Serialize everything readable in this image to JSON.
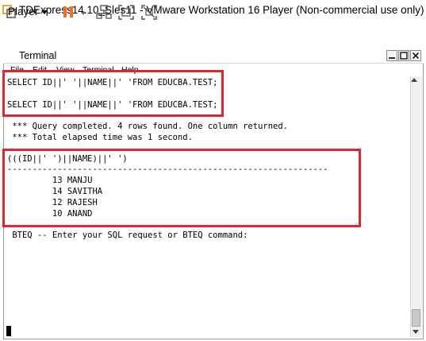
{
  "app": {
    "title": "TDExpress14.10_Sles11 - VMware Workstation 16 Player (Non-commercial use only)"
  },
  "toolbar": {
    "player_label": "Player",
    "icons": [
      "vmware-logo-icon",
      "pause-icon",
      "network-icon",
      "fullscreen-icon",
      "unity-icon"
    ]
  },
  "terminal": {
    "title": "Terminal",
    "menu": [
      "File",
      "Edit",
      "View",
      "Terminal",
      "Help"
    ],
    "commands": [
      "SELECT ID||' '||NAME||' 'FROM EDUCBA.TEST;",
      "SELECT ID||' '||NAME||' 'FROM EDUCBA.TEST;"
    ],
    "status": [
      " *** Query completed. 4 rows found. One column returned.",
      " *** Total elapsed time was 1 second."
    ],
    "result_header": "(((ID||' ')||NAME)||' ')",
    "result_separator": "---------------------------------------------------------------------------",
    "rows": [
      "         13 MANJU",
      "         14 SAVITHA",
      "         12 RAJESH",
      "         10 ANAND"
    ],
    "prompt": " BTEQ -- Enter your SQL request or BTEQ command:"
  },
  "colors": {
    "highlight": "#e3232e",
    "pause_orange": "#f36f21"
  }
}
